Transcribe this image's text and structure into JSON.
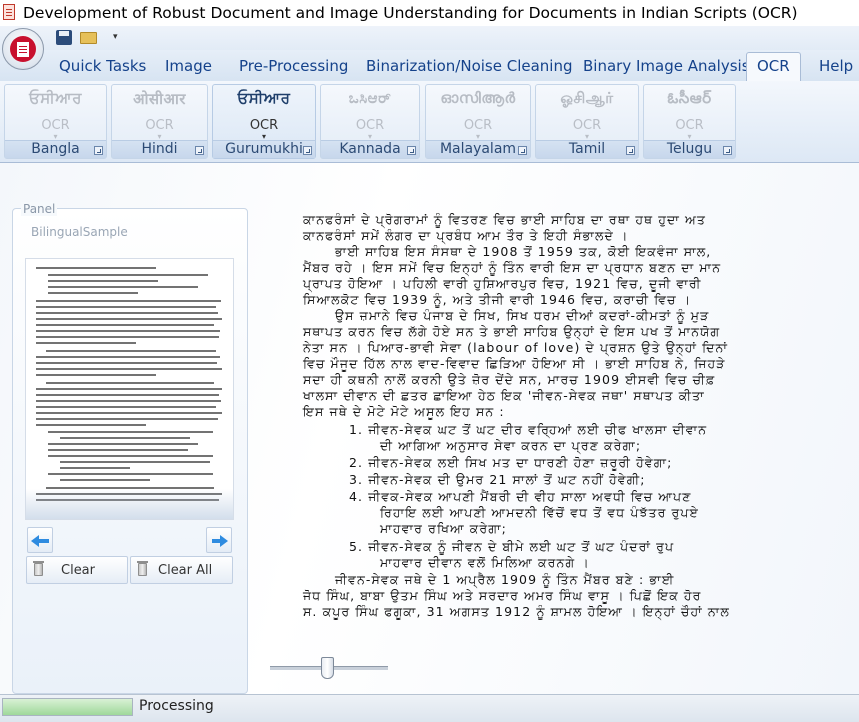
{
  "window": {
    "title": "Development of Robust Document and Image Understanding for Documents in Indian Scripts (OCR)"
  },
  "tabs": [
    {
      "label": "Quick Tasks",
      "active": false
    },
    {
      "label": "Image",
      "active": false
    },
    {
      "label": "Pre-Processing",
      "active": false
    },
    {
      "label": "Binarization/Noise Cleaning",
      "active": false
    },
    {
      "label": "Binary Image Analysis",
      "active": false
    },
    {
      "label": "OCR",
      "active": true
    },
    {
      "label": "Help",
      "active": false
    }
  ],
  "ocr_groups": [
    {
      "script_text": "ਓਸੀਆਰ",
      "button_label": "OCR",
      "group_label": "Bangla",
      "enabled": false
    },
    {
      "script_text": "ओसीआर",
      "button_label": "OCR",
      "group_label": "Hindi",
      "enabled": false
    },
    {
      "script_text": "ਓਸੀਆਰ",
      "button_label": "OCR",
      "group_label": "Gurumukhi",
      "enabled": true
    },
    {
      "script_text": "ಒಸಿಆರ್",
      "button_label": "OCR",
      "group_label": "Kannada",
      "enabled": false
    },
    {
      "script_text": "ഓസിആർ",
      "button_label": "OCR",
      "group_label": "Malayalam",
      "enabled": false
    },
    {
      "script_text": "ஓசிஆர்",
      "button_label": "OCR",
      "group_label": "Tamil",
      "enabled": false
    },
    {
      "script_text": "ఓసీఆర్",
      "button_label": "OCR",
      "group_label": "Telugu",
      "enabled": false
    }
  ],
  "panel": {
    "title": "Panel",
    "subtitle": "BilingualSample",
    "buttons": {
      "clear": "Clear",
      "clear_all": "Clear All"
    }
  },
  "document_lines": [
    "ਕਾਨਫਰੰਸਾਂ ਦੇ ਪ੍ਰੋਗਰਾਮਾਂ ਨੂੰ ਵਿਤਰਣ ਵਿਚ ਭਾਈ ਸਾਹਿਬ ਦਾ ਰਥਾ ਹਥ ਹੁਦਾ ਅਤ",
    "ਕਾਨਫਰੰਸਾਂ ਸਮੇਂ ਲੰਗਰ ਦਾ ਪ੍ਰਬੰਧ ਆਮ ਤੌਰ ਤੇ ਇਹੀ ਸੰਭਾਲਦੇ ।",
    "ਭਾਈ ਸਾਹਿਬ ਇਸ ਸੰਸਥਾ ਦੇ 1908 ਤੋਂ 1959 ਤਕ, ਕੋਈ ਇਕਵੰਜਾ ਸਾਲ,",
    "ਮੈਂਬਰ ਰਹੇ । ਇਸ ਸਮੇਂ ਵਿਚ ਇਨ੍ਹਾਂ ਨੂੰ ਤਿੰਨ ਵਾਰੀ ਇਸ ਦਾ ਪ੍ਰਧਾਨ ਬਣਨ ਦਾ ਮਾਨ",
    "ਪ੍ਰਾਪਤ ਹੋਇਆ । ਪਹਿਲੀ ਵਾਰੀ ਹੁਸ਼ਿਆਰਪੁਰ ਵਿਚ, 1921 ਵਿਚ, ਦੂਜੀ ਵਾਰੀ",
    "ਸਿਆਲਕੋਟ ਵਿਚ 1939 ਨੂੰ, ਅਤੇ ਤੀਜੀ ਵਾਰੀ 1946 ਵਿਚ, ਕਰਾਚੀ ਵਿਚ ।",
    "ਉਸ ਜ਼ਮਾਨੇ ਵਿਚ ਪੰਜਾਬ ਦੇ ਸਿਖ, ਸਿਖ ਧਰਮ ਦੀਆਂ ਕਦਰਾਂ-ਕੀਮਤਾਂ ਨੂੰ ਮੁੜ",
    "ਸਥਾਪਤ ਕਰਨ ਵਿਚ ਲੱਗੇ ਹੋਏ ਸਨ ਤੇ ਭਾਈ ਸਾਹਿਬ ਉਨ੍ਹਾਂ ਦੇ ਇਸ ਪਖ ਤੋਂ ਮਾਨਯੋਗ",
    "ਨੇਤਾ ਸਨ । ਪਿਆਰ-ਭਾਵੀ ਸੇਵਾ (labour of love) ਦੇ ਪ੍ਰਸ਼ਨ ਉਤੇ ਉਨ੍ਹਾਂ ਦਿਨਾਂ",
    "ਵਿਚ ਮੌਜੂਦ ਹਿੱਲ ਨਾਲ ਵਾਦ-ਵਿਵਾਦ ਛਿੜਿਆ ਹੋਇਆ ਸੀ । ਭਾਈ ਸਾਹਿਬ ਨੇ, ਜਿਹੜੇ",
    "ਸਦਾ ਹੀ ਕਥਨੀ ਨਾਲੋਂ ਕਰਨੀ ਉਤੇ ਜ਼ੋਰ ਦੇਂਦੇ ਸਨ, ਮਾਰਚ 1909 ਈਸਵੀ ਵਿਚ ਚੀਫ਼",
    "ਖਾਲਸਾ ਦੀਵਾਨ ਦੀ ਛਤਰ ਛਾਇਆ ਹੇਠ ਇਕ 'ਜੀਵਨ-ਸੇਵਕ ਜਥਾ' ਸਥਾਪਤ ਕੀਤਾ",
    "ਇਸ ਜਥੇ ਦੇ ਮੋਟੇ ਮੋਟੇ ਅਸੂਲ ਇਹ ਸਨ :",
    "1. ਜੀਵਨ-ਸੇਵਕ ਘਟ ਤੋਂ ਘਟ ਦੀਰ ਵਰ੍ਹਿਆਂ ਲਈ ਚੀਫ ਖਾਲਸਾ ਦੀਵਾਨ",
    "ਦੀ ਆਗਿਆ ਅਨੁਸਾਰ ਸੇਵਾ ਕਰਨ ਦਾ ਪ੍ਰਣ ਕਰੇਗਾ;",
    "2. ਜੀਵਨ-ਸੇਵਕ ਲਈ ਸਿਖ ਮਤ ਦਾ ਧਾਰਣੀ ਹੋਣਾ ਜ਼ਰੂਰੀ ਹੋਵੇਗਾ;",
    "3. ਜੀਵਨ-ਸੇਵਕ ਦੀ ਉਮਰ 21 ਸਾਲਾਂ ਤੋਂ ਘਟ ਨਹੀਂ ਹੋਵੇਗੀ;",
    "4. ਜੀਵਕ-ਸੇਵਕ ਆਪਣੀ ਮੈਂਬਰੀ ਦੀ ਵੀਹ ਸਾਲਾ ਅਵਧੀ ਵਿਚ ਆਪਣ",
    "ਰਿਹਾਇ ਲਈ ਆਪਣੀ ਆਮਦਨੀ ਵਿੱਚੋਂ ਵਧ ਤੋਂ ਵਧ ਪੰਝੱਤਰ ਰੁਪਏ",
    "ਮਾਹਵਾਰ ਰਖਿਆ ਕਰੇਗਾ;",
    "5. ਜੀਵਨ-ਸੇਵਕ ਨੂੰ ਜੀਵਨ ਦੇ ਬੀਮੇ ਲਈ ਘਟ ਤੋਂ ਘਟ ਪੰਦਰਾਂ ਰੁਪ",
    "ਮਾਹਵਾਰ ਦੀਵਾਨ ਵਲੋਂ ਮਿਲਿਆ ਕਰਨਗੇ ।",
    "ਜੀਵਨ-ਸੇਵਕ ਜਥੇ ਦੇ 1 ਅਪ੍ਰੈਲ 1909 ਨੂੰ ਤਿੰਨ ਮੈਂਬਰ ਬਣੇ : ਭਾਈ",
    "ਜੋਧ ਸਿੰਘ, ਬਾਬਾ ਉਤਮ ਸਿੰਘ ਅਤੇ ਸਰਦਾਰ ਅਮਰ ਸਿੰਘ ਵਾਸੂ । ਪਿਛੋਂ ਇਕ ਹੋਰ",
    "ਸ. ਕਪੂਰ ਸਿੰਘ ਫਗੂਕਾ, 31 ਅਗਸਤ 1912 ਨੂੰ ਸ਼ਾਮਲ ਹੋਇਆ । ਇਨ੍ਹਾਂ ਚੌਹਾਂ ਨਾਲ"
  ],
  "zoom_slider": {
    "value": 0.45
  },
  "status": {
    "text": "Processing",
    "progress": 1.0
  }
}
